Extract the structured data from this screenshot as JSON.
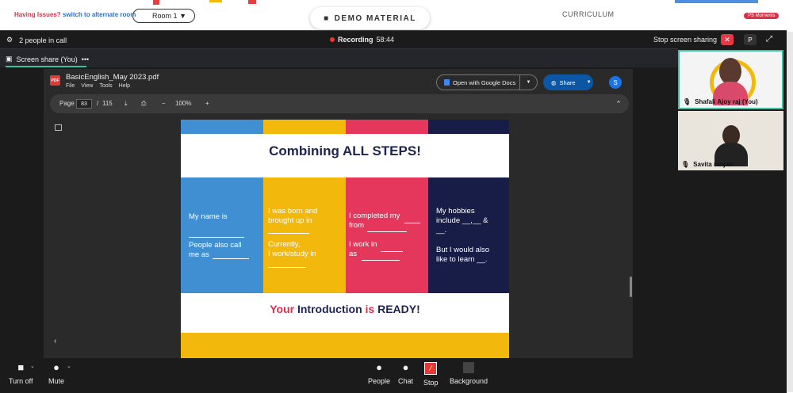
{
  "top": {
    "issue_text": "Having Issues?",
    "issue_link": "switch to alternate room",
    "room_label": "Room 1",
    "demo_label": "DEMO MATERIAL",
    "curriculum_label": "CURRICULUM",
    "moments_label": "PS Moments"
  },
  "call": {
    "people_label": "2 people in call",
    "recording_label": "Recording",
    "recording_time": "58:44",
    "stop_share_label": "Stop screen sharing",
    "p_label": "P",
    "close_glyph": "✕",
    "expand_glyph": "⤢",
    "share_tab_label": "Screen share (You)",
    "more_glyph": "•••"
  },
  "viewer": {
    "file_name": "BasicEnglish_May 2023.pdf",
    "menu": [
      "File",
      "View",
      "Tools",
      "Help"
    ],
    "open_gdocs": "Open with Google Docs",
    "share_label": "Share",
    "avatar_letter": "S",
    "page_label": "Page",
    "page_current": "83",
    "page_sep": "/",
    "page_total": "115",
    "zoom": "100%",
    "pdf_badge": "PDF"
  },
  "slide": {
    "title": "Combining ALL STEPS!",
    "col1": {
      "a": "My name is",
      "b": "People also call",
      "c": "me as"
    },
    "col2": {
      "a": "I was born and",
      "b": "brought up in",
      "c": "Currently,",
      "d": "I work/study in"
    },
    "col3": {
      "a": "I completed my",
      "b": "from",
      "c": "I work in",
      "d": "as"
    },
    "col4": {
      "a": "My hobbies",
      "b": "include __,__ &",
      "c": "__.",
      "d": "But I would also",
      "e": "like to learn __."
    },
    "bottom_w1": "Your",
    "bottom_w2": "Introduction",
    "bottom_w3": "is",
    "bottom_w4": "READY!",
    "colors": {
      "blue": "#3f8fd2",
      "yellow": "#f2b90c",
      "red": "#e5375c",
      "navy": "#181d47"
    }
  },
  "participants": [
    {
      "name": "Shafali Ajoy raj (You)"
    },
    {
      "name": "Savita ranjan"
    }
  ],
  "controls": {
    "turn_off": "Turn off",
    "mute": "Mute",
    "people": "People",
    "chat": "Chat",
    "stop": "Stop",
    "background": "Background"
  }
}
